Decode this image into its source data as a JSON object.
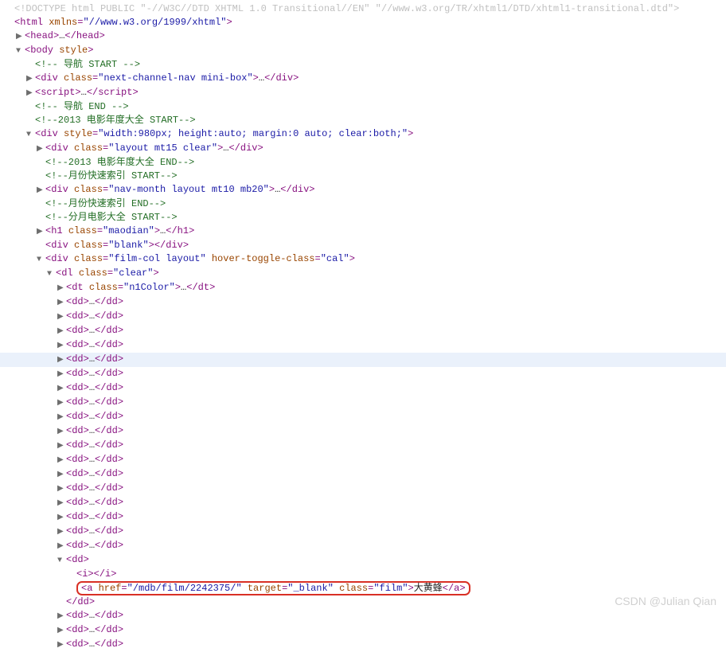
{
  "doctype": "<!DOCTYPE html PUBLIC \"-//W3C//DTD XHTML 1.0 Transitional//EN\" \"//www.w3.org/TR/xhtml1/DTD/xhtml1-transitional.dtd\">",
  "htmlOpen": {
    "tag": "html",
    "attrRaw": "xmlns=\"//www.w3.org/1999/xhtml\""
  },
  "headCollapsed": {
    "tag": "head"
  },
  "bodyOpen": {
    "tag": "body",
    "attrRaw": "style"
  },
  "comments": {
    "navStart": "<!-- 导航 START  -->",
    "navEnd": "<!-- 导航 END  -->",
    "year2013Start": "<!--2013 电影年度大全  START-->",
    "year2013End": "<!--2013 电影年度大全 END-->",
    "monthIdxStart": "<!--月份快速索引 START-->",
    "monthIdxEnd": "<!--月份快速索引 END-->",
    "monthFilmStart": "<!--分月电影大全 START-->"
  },
  "divNav": {
    "tag": "div",
    "attrRaw": "class=\"next-channel-nav mini-box\""
  },
  "scriptCollapsed": {
    "tag": "script"
  },
  "div980": {
    "tag": "div",
    "attrRaw": "style=\"width:980px; height:auto; margin:0 auto; clear:both;\""
  },
  "divLayoutMt15": {
    "tag": "div",
    "attrRaw": "class=\"layout mt15 clear\""
  },
  "divNavMonth": {
    "tag": "div",
    "attrRaw": "class=\"nav-month layout mt10 mb20\""
  },
  "h1Maodian": {
    "tag": "h1",
    "attrRaw": "class=\"maodian\""
  },
  "divBlank": {
    "tag": "div",
    "attrRaw": "class=\"blank\""
  },
  "divFilmCol": {
    "tag": "div",
    "attrRaw": "class=\"film-col layout\" hover-toggle-class=\"cal\""
  },
  "dlClear": {
    "tag": "dl",
    "attrRaw": "class=\"clear\""
  },
  "dtN1": {
    "tag": "dt",
    "attrRaw": "class=\"n1Color\""
  },
  "ddList": {
    "count": 22,
    "highlightIdx": 4,
    "expandIdx": 18
  },
  "expandedDd": {
    "iTag": {
      "tag": "i"
    },
    "anchor": {
      "href": "/mdb/film/2242375/",
      "target": "_blank",
      "class": "film",
      "text": "大黄蜂"
    }
  },
  "watermark": "CSDN @Julian Qian"
}
